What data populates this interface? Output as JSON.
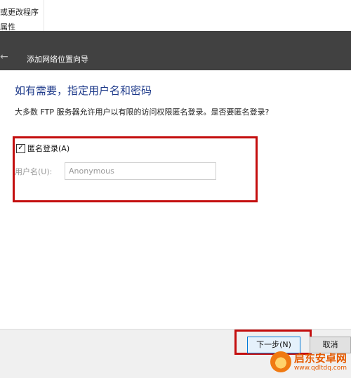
{
  "background": {
    "items": [
      "或更改程序",
      "属性"
    ]
  },
  "wizard": {
    "title": "添加网络位置向导",
    "heading": "如有需要，指定用户名和密码",
    "description": "大多数 FTP 服务器允许用户以有限的访问权限匿名登录。是否要匿名登录?",
    "anonymous_checkbox": {
      "label": "匿名登录(A)",
      "checked": true,
      "check_glyph": "☑"
    },
    "username": {
      "label": "用户名(U):",
      "value": "Anonymous"
    },
    "buttons": {
      "next": "下一步(N)",
      "cancel": "取消"
    }
  },
  "watermark": {
    "name": "启东安卓网",
    "url": "www.qdltdq.com"
  },
  "colors": {
    "titlebar": "#414141",
    "heading": "#1e3a8a",
    "highlight_red": "#c40e0e",
    "primary_button_border": "#0078d7"
  }
}
